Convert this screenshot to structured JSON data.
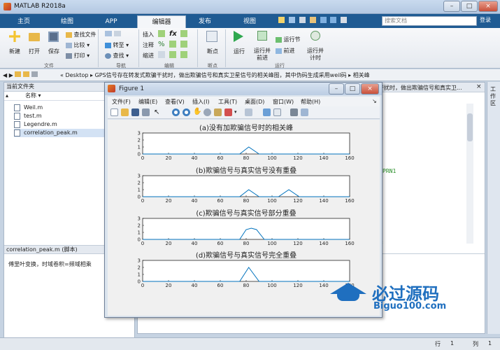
{
  "window": {
    "title": "MATLAB R2018a",
    "min": "–",
    "max": "□",
    "close": "×"
  },
  "tabs": [
    "主页",
    "绘图",
    "APP",
    "编辑器",
    "发布",
    "视图"
  ],
  "search_placeholder": "搜索文档",
  "login": "登录",
  "ribbon": {
    "new": "新建",
    "open": "打开",
    "save": "保存",
    "find_files": "查找文件",
    "compare": "比较",
    "print": "打印",
    "goto": "转至",
    "find": "查找",
    "insert": "插入",
    "comment": "注释",
    "indent": "缩进",
    "breakpoints": "断点",
    "run": "运行",
    "run_advance": "运行并\n前进",
    "run_section": "运行节",
    "advance": "前进",
    "run_time": "运行并\n计时",
    "groups": [
      "文件",
      "导航",
      "编辑",
      "断点",
      "运行"
    ]
  },
  "path": {
    "parts": [
      "Desktop",
      "GPS信号存在转发式欺骗干扰时，做出欺骗信号和真实卫星信号的相关峰图，其中伪码生成采用weil码",
      "相关峰"
    ]
  },
  "left_panel": {
    "title": "当前文件夹",
    "column_header": "名称",
    "files": [
      "Weil.m",
      "test.m",
      "Legendre.m",
      "correlation_peak.m"
    ],
    "selected_index": 3,
    "details_title": "correlation_peak.m  (脚本)",
    "details_text": "傅里叶变换，时域卷积=频域相乘"
  },
  "editor": {
    "behind_title": "干扰时，做出欺骗信号和真实卫...",
    "code_fragment": "PRN1",
    "star": "*"
  },
  "right_strip_label": "工作区",
  "statusbar": {
    "row_label": "行",
    "row_value": "1",
    "col_label": "列",
    "col_value": "1"
  },
  "figure": {
    "title": "Figure 1",
    "menu": [
      "文件(F)",
      "编辑(E)",
      "查看(V)",
      "插入(I)",
      "工具(T)",
      "桌面(D)",
      "窗口(W)",
      "帮助(H)"
    ]
  },
  "chart_data": [
    {
      "type": "line",
      "title": "(a)没有加欺骗信号时的相关峰",
      "x": [
        0,
        75,
        82,
        90,
        160
      ],
      "series": [
        {
          "values": [
            0,
            0,
            1,
            0,
            0
          ]
        }
      ],
      "xlim": [
        0,
        160
      ],
      "ylim": [
        0,
        3
      ],
      "xticks": [
        0,
        20,
        40,
        60,
        80,
        100,
        120,
        140,
        160
      ],
      "yticks": [
        0,
        1,
        2,
        3
      ]
    },
    {
      "type": "line",
      "title": "(b)欺骗信号与真实信号没有重叠",
      "x": [
        0,
        75,
        82,
        90,
        105,
        113,
        121,
        160
      ],
      "series": [
        {
          "values": [
            0,
            0,
            1,
            0,
            0,
            1,
            0,
            0
          ]
        }
      ],
      "xlim": [
        0,
        160
      ],
      "ylim": [
        0,
        3
      ],
      "xticks": [
        0,
        20,
        40,
        60,
        80,
        100,
        120,
        140,
        160
      ],
      "yticks": [
        0,
        1,
        2,
        3
      ]
    },
    {
      "type": "line",
      "title": "(c)欺骗信号与真实信号部分重叠",
      "x": [
        0,
        75,
        80,
        84,
        88,
        94,
        160
      ],
      "series": [
        {
          "values": [
            0,
            0,
            1.4,
            1.6,
            1.4,
            0,
            0
          ]
        }
      ],
      "xlim": [
        0,
        160
      ],
      "ylim": [
        0,
        3
      ],
      "xticks": [
        0,
        20,
        40,
        60,
        80,
        100,
        120,
        140,
        160
      ],
      "yticks": [
        0,
        1,
        2,
        3
      ]
    },
    {
      "type": "line",
      "title": "(d)欺骗信号与真实信号完全重叠",
      "x": [
        0,
        75,
        82,
        90,
        160
      ],
      "series": [
        {
          "values": [
            0,
            0,
            2,
            0,
            0
          ]
        }
      ],
      "xlim": [
        0,
        160
      ],
      "ylim": [
        0,
        3
      ],
      "xticks": [
        0,
        20,
        40,
        60,
        80,
        100,
        120,
        140,
        160
      ],
      "yticks": [
        0,
        1,
        2,
        3
      ]
    }
  ],
  "watermark": {
    "text": "必过源码",
    "url": "Biguo100.com"
  },
  "colors": {
    "line": "#0072bd",
    "tab_bar": "#1f5b93",
    "selected_row": "#d3e2f4"
  }
}
